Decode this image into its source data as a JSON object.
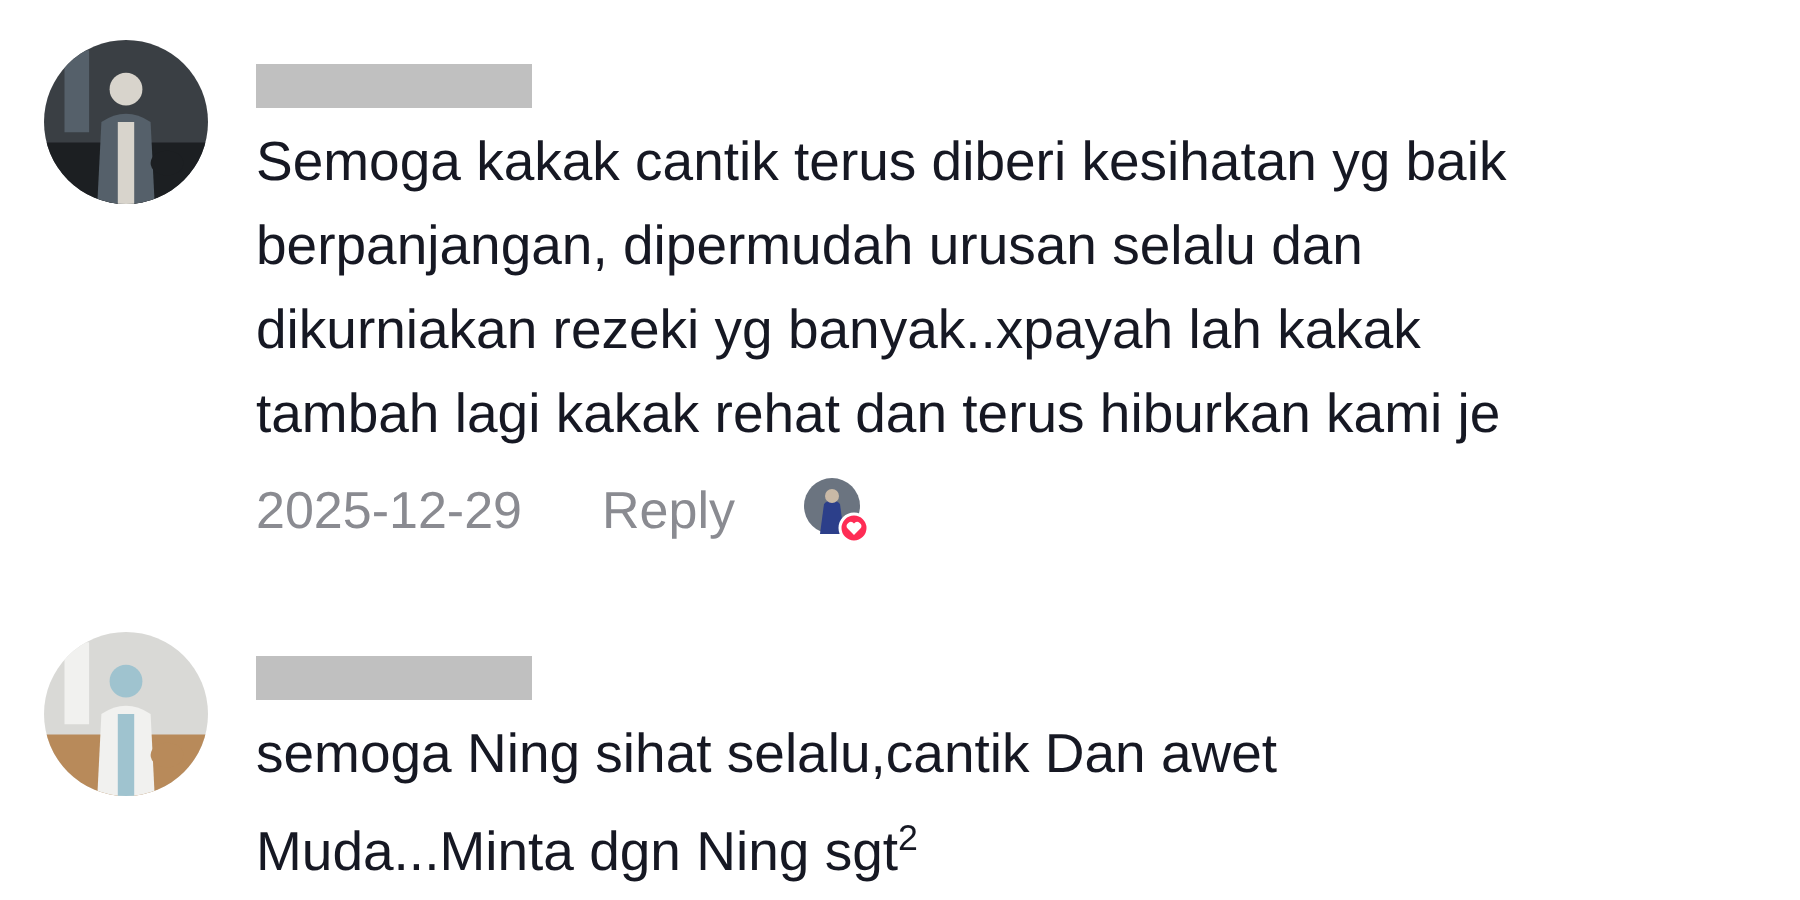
{
  "comments": [
    {
      "text": "Semoga kakak cantik terus diberi kesihatan yg baik\nberpanjangan, dipermudah urusan selalu dan\ndikurniakan rezeki yg banyak..xpayah lah kakak\ntambah lagi kakak rehat dan terus hiburkan kami je",
      "date": "2025-12-29",
      "reply": "Reply",
      "liked_by_creator": true
    },
    {
      "text": "semoga Ning sihat selalu,cantik Dan awet\nMuda...Minta dgn Ning sgt$^{2}$"
    }
  ]
}
